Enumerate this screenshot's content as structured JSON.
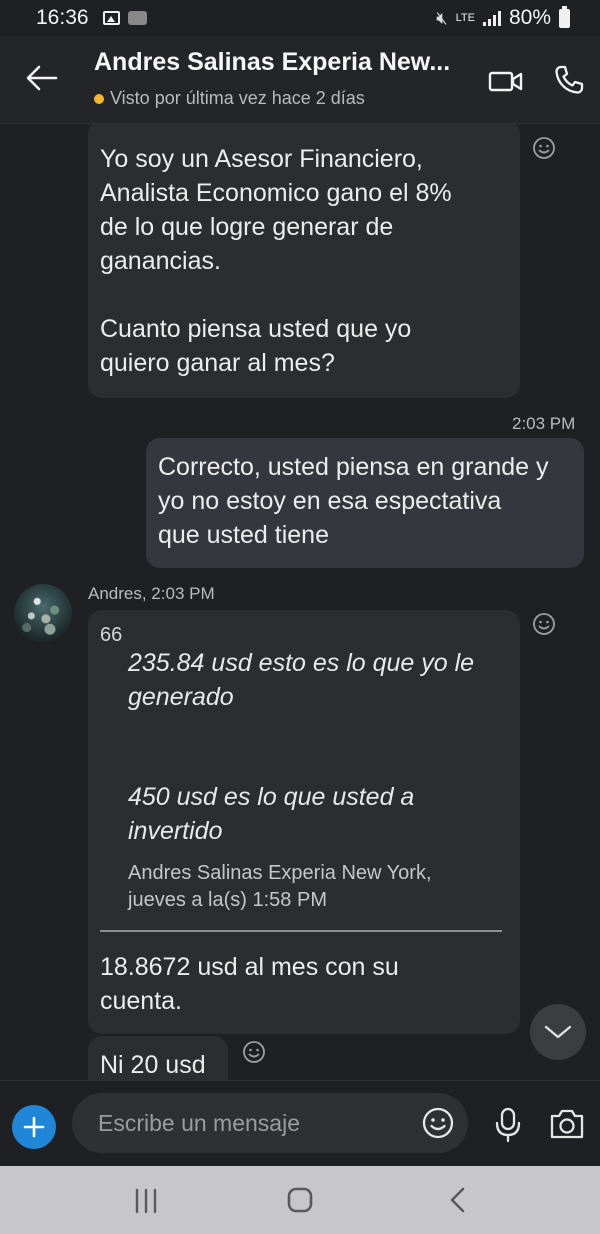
{
  "status_bar": {
    "time": "16:36",
    "network": "LTE",
    "battery": "80%"
  },
  "header": {
    "title": "Andres Salinas Experia New...",
    "presence": "Visto por última vez hace 2 días",
    "presence_color": "#f5b72a"
  },
  "messages": {
    "first_incoming": "Yo soy un Asesor Financiero,\nAnalista Economico gano el 8%\nde lo que logre generar de\nganancias.\n\nCuanto piensa usted que yo\nquiero ganar al mes?",
    "outgoing_time": "2:03 PM",
    "outgoing": "Correcto, usted piensa en grande y\nyo no estoy en esa espectativa\nque usted tiene",
    "sender_meta": "Andres, 2:03 PM",
    "quote_mark": "66",
    "quote_line1": "235.84 usd esto es lo que yo le\ngenerado",
    "quote_line2": "450 usd es lo que usted a\ninvertido",
    "quote_author": "Andres Salinas Experia New York,\njueves a la(s) 1:58 PM",
    "reply_text": "18.8672 usd al mes con su\ncuenta.",
    "last_incoming": "Ni 20 usd"
  },
  "composer": {
    "placeholder": "Escribe un mensaje",
    "accent": "#1f86d8"
  },
  "icons": [
    "back-arrow-icon",
    "video-call-icon",
    "phone-icon",
    "reaction-smiley-icon",
    "chevron-down-icon",
    "plus-icon",
    "emoji-icon",
    "microphone-icon",
    "camera-icon",
    "nav-recent-apps-icon",
    "nav-home-icon",
    "nav-back-icon"
  ]
}
